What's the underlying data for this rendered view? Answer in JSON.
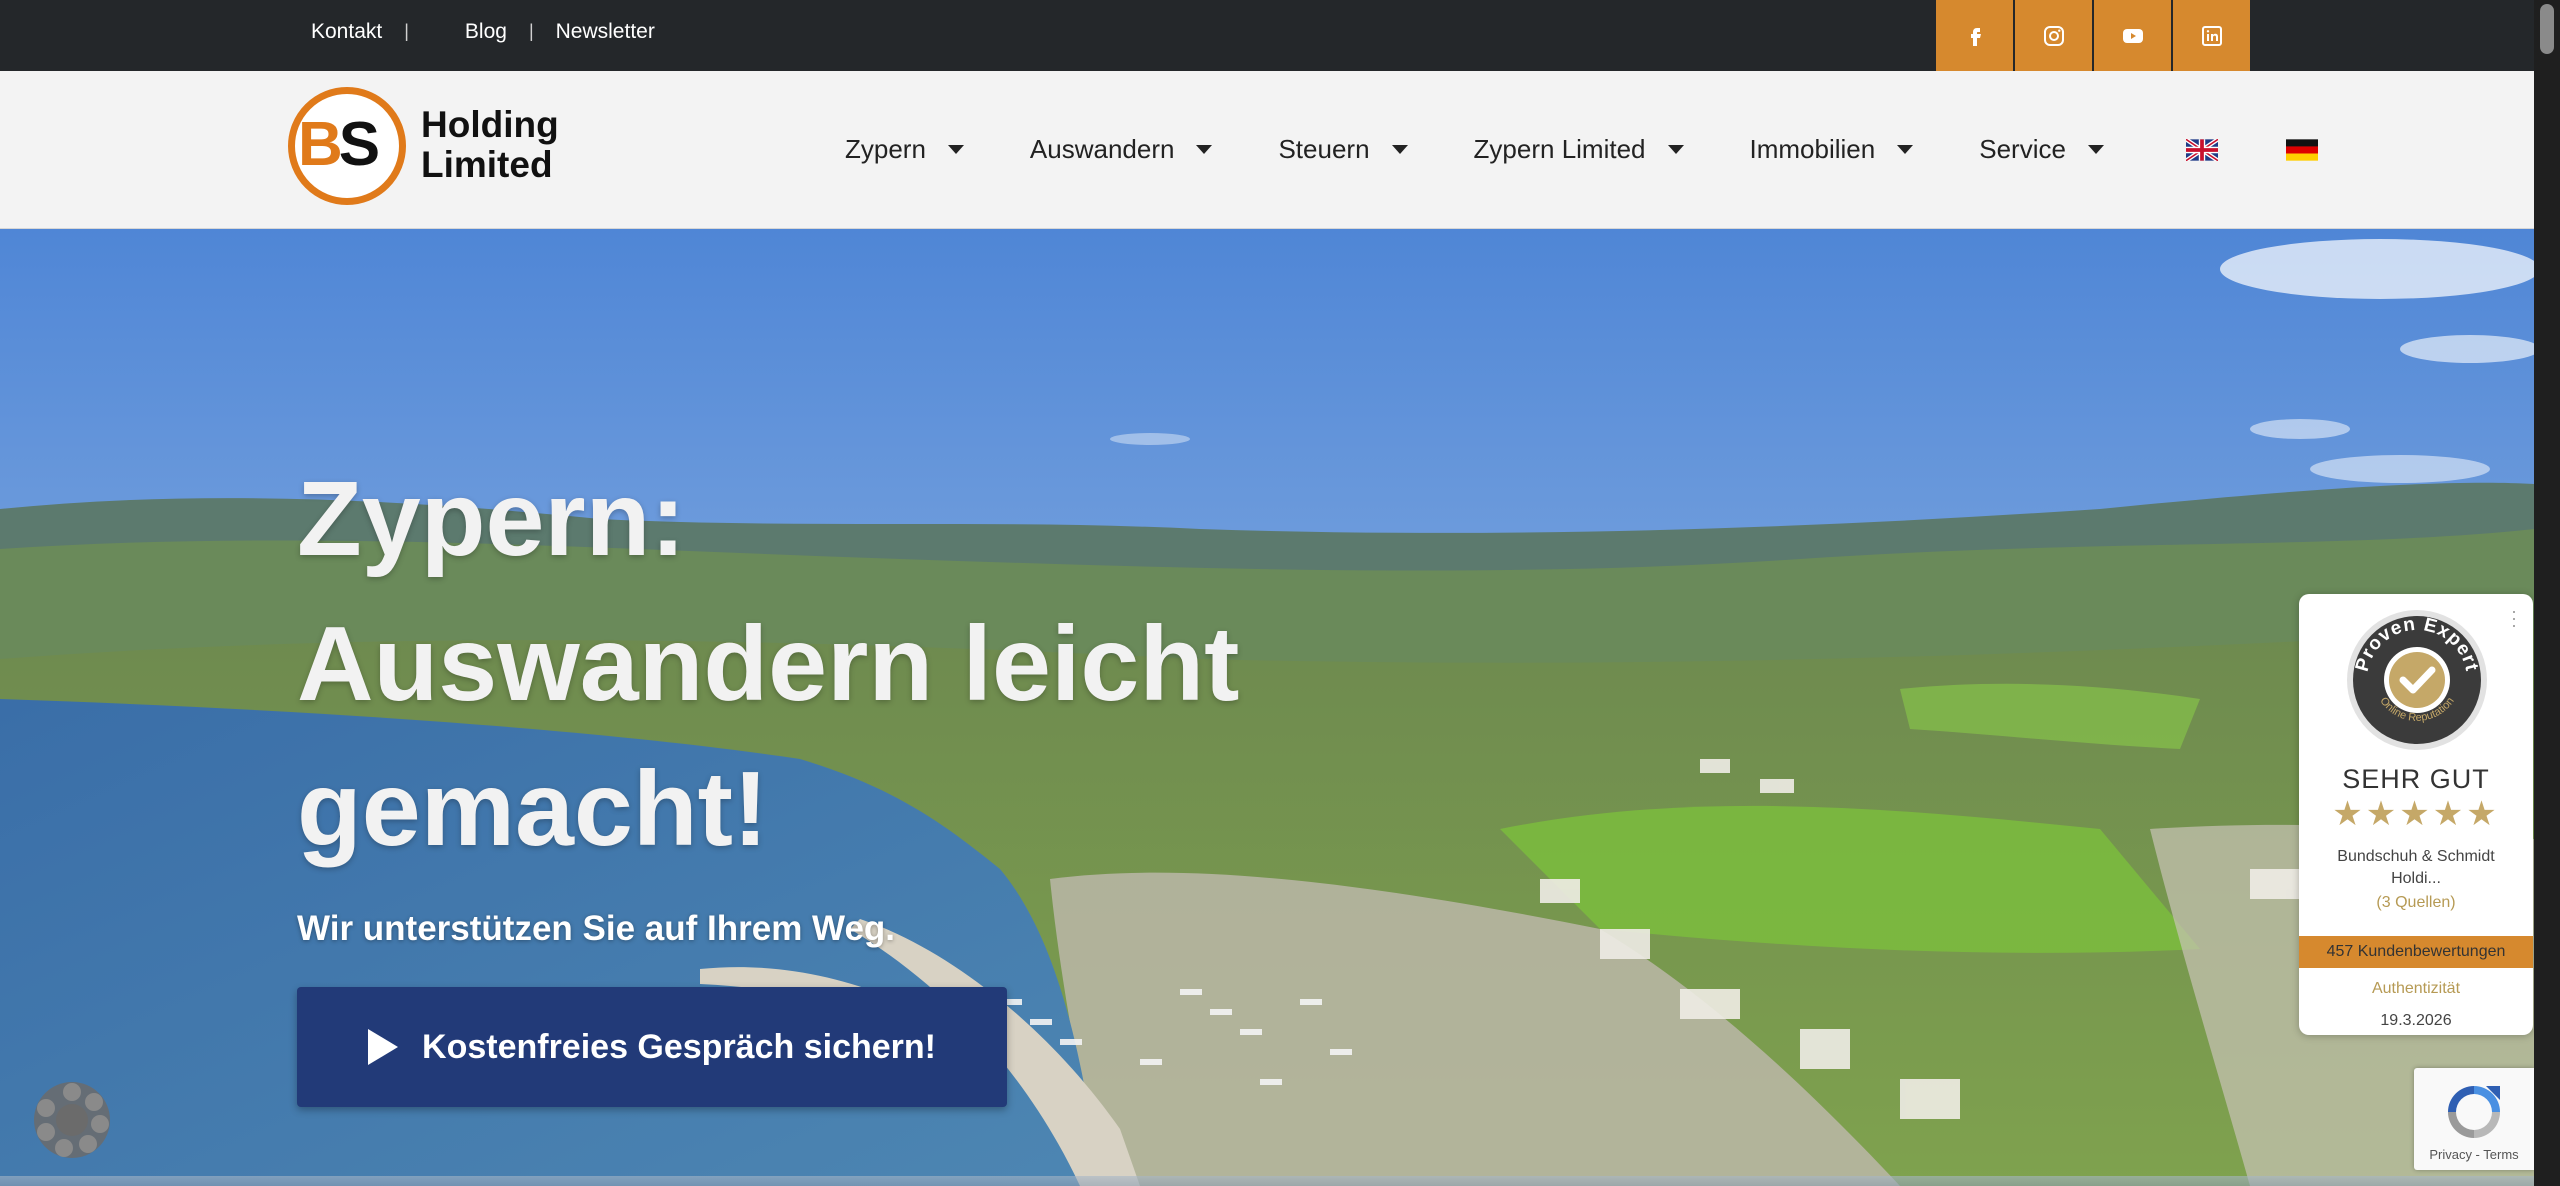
{
  "topbar": {
    "links": [
      "Kontakt",
      "Blog",
      "Newsletter"
    ],
    "separator": "|",
    "socials": [
      "facebook-icon",
      "instagram-icon",
      "youtube-icon",
      "linkedin-icon"
    ],
    "accent_color": "#d6892e",
    "background": "#24272a"
  },
  "header": {
    "logo": {
      "mark": "BS",
      "line1": "Holding",
      "line2": "Limited",
      "ring_color": "#e07a1a"
    },
    "nav": [
      "Zypern",
      "Auswandern",
      "Steuern",
      "Zypern Limited",
      "Immobilien",
      "Service"
    ],
    "languages": [
      "english-flag-icon",
      "german-flag-icon"
    ]
  },
  "hero": {
    "title_lines": [
      "Zypern:",
      "Auswandern leicht",
      "gemacht!"
    ],
    "subtitle": "Wir unterstützen Sie auf Ihrem Weg.",
    "cta_label": "Kostenfreies Gespräch sichern!",
    "cta_color": "#223a78"
  },
  "proven_expert": {
    "seal_top": "Proven Expert",
    "seal_bottom": "Online Reputation",
    "rating": "SEHR GUT",
    "stars": "★★★★★",
    "name": "Bundschuh & Schmidt Holdi...",
    "sources": "(3 Quellen)",
    "reviews": "457 Kundenbewertungen",
    "authenticity": "Authentizität",
    "date": "19.3.2026"
  },
  "recaptcha": {
    "terms": "Privacy - Terms"
  }
}
